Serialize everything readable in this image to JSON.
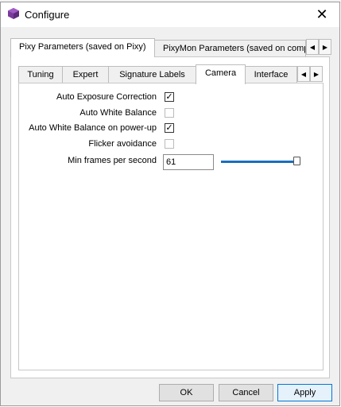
{
  "window": {
    "title": "Configure",
    "close_icon": "close-icon",
    "app_icon": "pixy-cube-icon",
    "accent_color": "#1a6ec0"
  },
  "outer_tabs": [
    {
      "label": "Pixy Parameters (saved on Pixy)",
      "active": true
    },
    {
      "label": "PixyMon Parameters (saved on computer)",
      "active": false
    }
  ],
  "inner_tabs": [
    {
      "label": "Tuning",
      "active": false
    },
    {
      "label": "Expert",
      "active": false
    },
    {
      "label": "Signature Labels",
      "active": false
    },
    {
      "label": "Camera",
      "active": true
    },
    {
      "label": "Interface",
      "active": false
    }
  ],
  "camera": {
    "auto_exposure": {
      "label": "Auto Exposure Correction",
      "checked": true
    },
    "auto_white_balance": {
      "label": "Auto White Balance",
      "checked": false
    },
    "awb_power_up": {
      "label": "Auto White Balance on power-up",
      "checked": true
    },
    "flicker_avoidance": {
      "label": "Flicker avoidance",
      "checked": false
    },
    "min_fps": {
      "label": "Min frames per second",
      "value": "61",
      "slider_fraction": 1.0
    }
  },
  "buttons": {
    "ok": "OK",
    "cancel": "Cancel",
    "apply": "Apply"
  }
}
